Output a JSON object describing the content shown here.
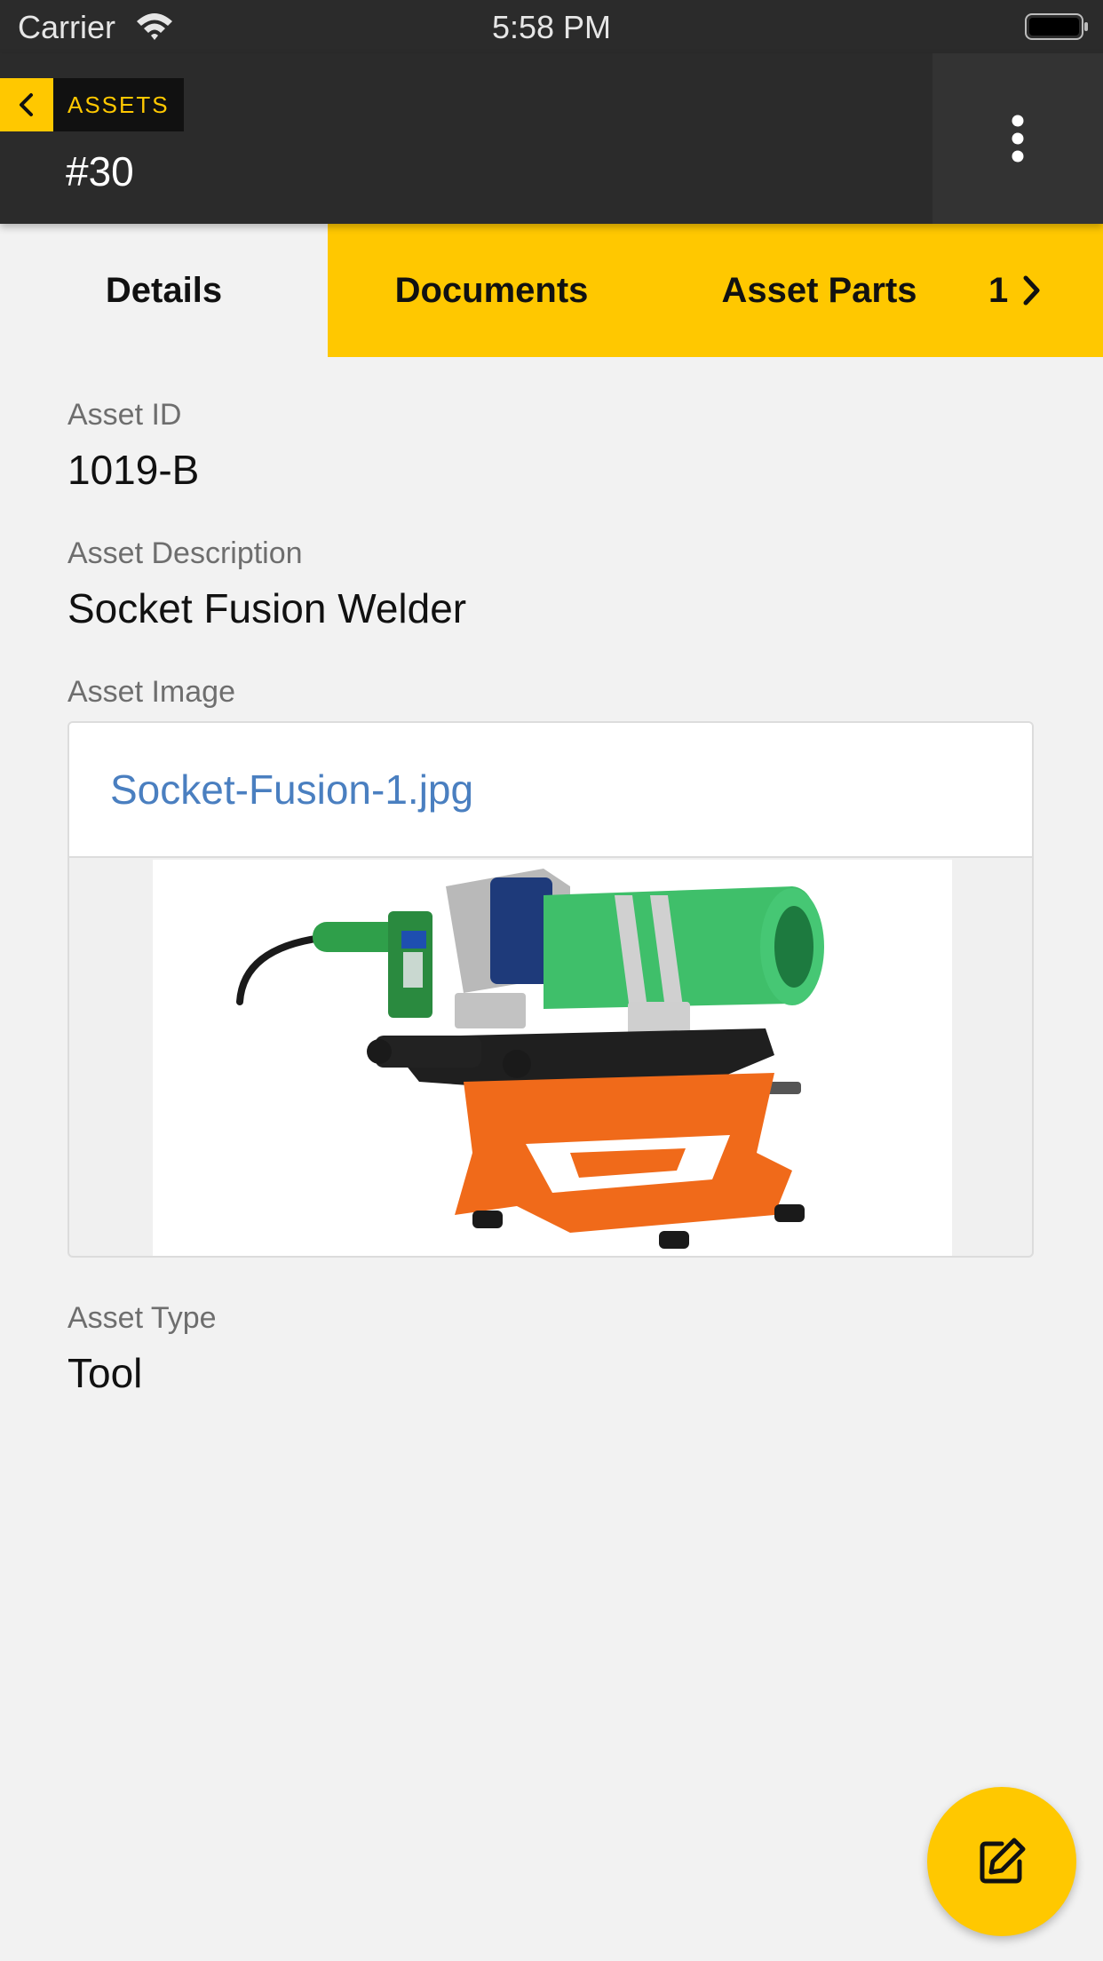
{
  "status_bar": {
    "carrier": "Carrier",
    "time": "5:58 PM"
  },
  "header": {
    "breadcrumb": "ASSETS",
    "title": "#30"
  },
  "tabs": [
    {
      "label": "Details",
      "active": true
    },
    {
      "label": "Documents",
      "active": false
    },
    {
      "label": "Asset Parts",
      "active": false
    },
    {
      "label": "1",
      "active": false
    }
  ],
  "fields": {
    "asset_id": {
      "label": "Asset ID",
      "value": "1019-B"
    },
    "asset_description": {
      "label": "Asset Description",
      "value": "Socket Fusion Welder"
    },
    "asset_image": {
      "label": "Asset Image",
      "filename": "Socket-Fusion-1.jpg"
    },
    "asset_type": {
      "label": "Asset Type",
      "value": "Tool"
    }
  },
  "icons": {
    "back": "chevron-left-icon",
    "more": "more-vertical-icon",
    "next": "chevron-right-icon",
    "fab": "edit-icon"
  },
  "colors": {
    "accent": "#ffc800",
    "header": "#2b2b2b",
    "link": "#4a7fc0"
  }
}
